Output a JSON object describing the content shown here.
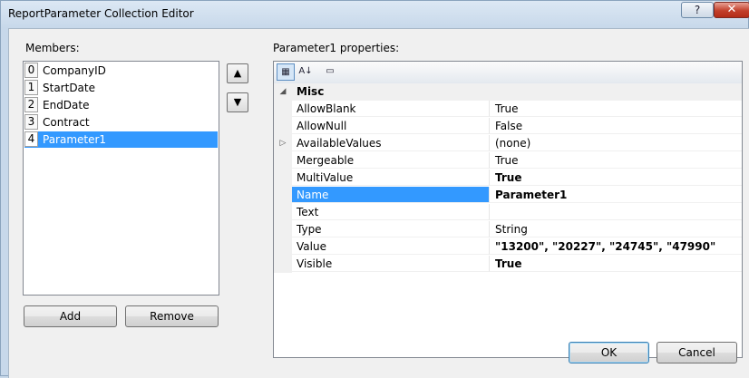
{
  "window": {
    "title": "ReportParameter Collection Editor",
    "help_label": "?",
    "close_label": "✕"
  },
  "members": {
    "label": "Members:",
    "items": [
      {
        "index": "0",
        "name": "CompanyID"
      },
      {
        "index": "1",
        "name": "StartDate"
      },
      {
        "index": "2",
        "name": "EndDate"
      },
      {
        "index": "3",
        "name": "Contract"
      },
      {
        "index": "4",
        "name": "Parameter1"
      }
    ],
    "selected_index": 4,
    "move_up_icon": "▲",
    "move_down_icon": "▼",
    "add_label": "Add",
    "remove_label": "Remove"
  },
  "properties": {
    "label": "Parameter1 properties:",
    "toolbar": {
      "categorized_icon": "▦",
      "alphabetical_icon": "A↓",
      "property_pages_icon": "▭"
    },
    "category": {
      "expander": "◢",
      "name": "Misc"
    },
    "rows": [
      {
        "name": "AllowBlank",
        "value": "True",
        "bold": false,
        "expander": ""
      },
      {
        "name": "AllowNull",
        "value": "False",
        "bold": false,
        "expander": ""
      },
      {
        "name": "AvailableValues",
        "value": "(none)",
        "bold": false,
        "expander": "▷"
      },
      {
        "name": "Mergeable",
        "value": "True",
        "bold": false,
        "expander": ""
      },
      {
        "name": "MultiValue",
        "value": "True",
        "bold": true,
        "expander": ""
      },
      {
        "name": "Name",
        "value": "Parameter1",
        "bold": true,
        "expander": "",
        "selected": true
      },
      {
        "name": "Text",
        "value": "",
        "bold": false,
        "expander": ""
      },
      {
        "name": "Type",
        "value": "String",
        "bold": false,
        "expander": ""
      },
      {
        "name": "Value",
        "value": "\"13200\", \"20227\", \"24745\", \"47990\"",
        "bold": true,
        "expander": ""
      },
      {
        "name": "Visible",
        "value": "True",
        "bold": true,
        "expander": ""
      }
    ]
  },
  "footer": {
    "ok_label": "OK",
    "cancel_label": "Cancel"
  }
}
